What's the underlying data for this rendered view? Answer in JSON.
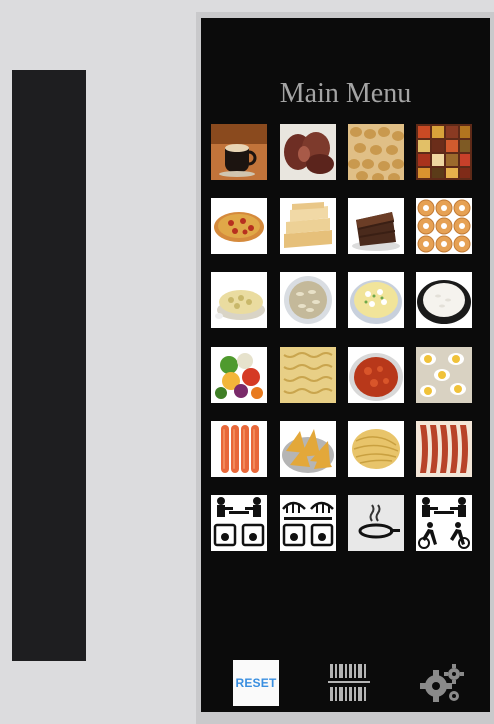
{
  "menu": {
    "title": "Main Menu"
  },
  "tiles": [
    {
      "name": "coffee-cup-tile"
    },
    {
      "name": "roast-meat-tile"
    },
    {
      "name": "peanuts-tile"
    },
    {
      "name": "spices-tile"
    },
    {
      "name": "pizza-tile"
    },
    {
      "name": "flatbread-tile"
    },
    {
      "name": "chocolate-cake-tile"
    },
    {
      "name": "donuts-tile"
    },
    {
      "name": "pasta-salad-tile"
    },
    {
      "name": "sunflower-seeds-tile"
    },
    {
      "name": "egg-salad-tile"
    },
    {
      "name": "rice-bowl-tile"
    },
    {
      "name": "vegetables-tile"
    },
    {
      "name": "fusilli-pasta-tile"
    },
    {
      "name": "tomato-sauce-tile"
    },
    {
      "name": "deviled-eggs-tile"
    },
    {
      "name": "sausages-tile"
    },
    {
      "name": "tortilla-chips-tile"
    },
    {
      "name": "spaghetti-tile"
    },
    {
      "name": "bacon-tile"
    },
    {
      "name": "chef-scale-tile"
    },
    {
      "name": "grill-scale-tile"
    },
    {
      "name": "frying-pan-tile"
    },
    {
      "name": "chef-activity-tile"
    }
  ],
  "footer": {
    "reset_label": "RESET"
  },
  "colors": {
    "screen_bg": "#0b0b0b",
    "title": "#a4a4a4",
    "reset_text": "#3a8fe0",
    "gear": "#8a8a8a"
  }
}
